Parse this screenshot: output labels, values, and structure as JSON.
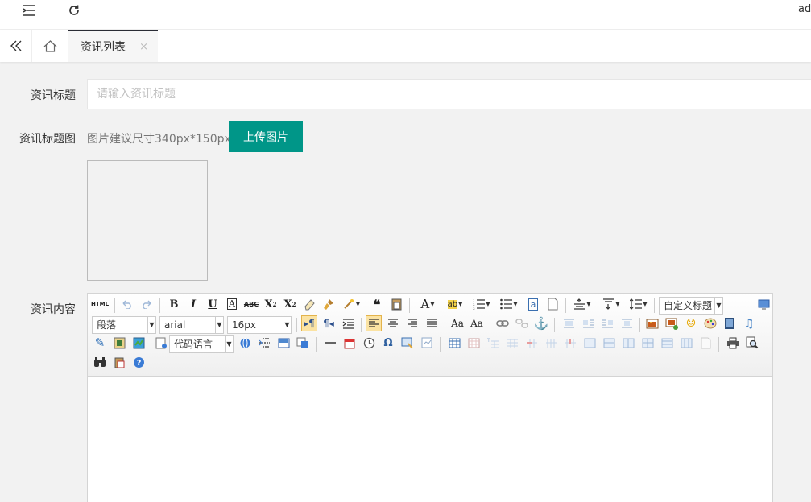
{
  "header": {
    "user_label": "ad"
  },
  "tabs": [
    {
      "label": "资讯列表",
      "close": "×"
    }
  ],
  "form": {
    "title_label": "资讯标题",
    "title_placeholder": "请输入资讯标题",
    "title_value": "",
    "image_label": "资讯标题图",
    "image_hint": "图片建议尺寸340px*150px",
    "upload_label": "上传图片",
    "content_label": "资讯内容"
  },
  "editor": {
    "html_label": "HTML",
    "custom_title": "自定义标题",
    "paragraph": "段落",
    "font_family": "arial",
    "font_size": "16px",
    "code_language": "代码语言",
    "omega": "Ω"
  },
  "colors": {
    "accent": "#009688",
    "tab_active_border": "#292b34",
    "help_icon": "#3a7bd5"
  }
}
